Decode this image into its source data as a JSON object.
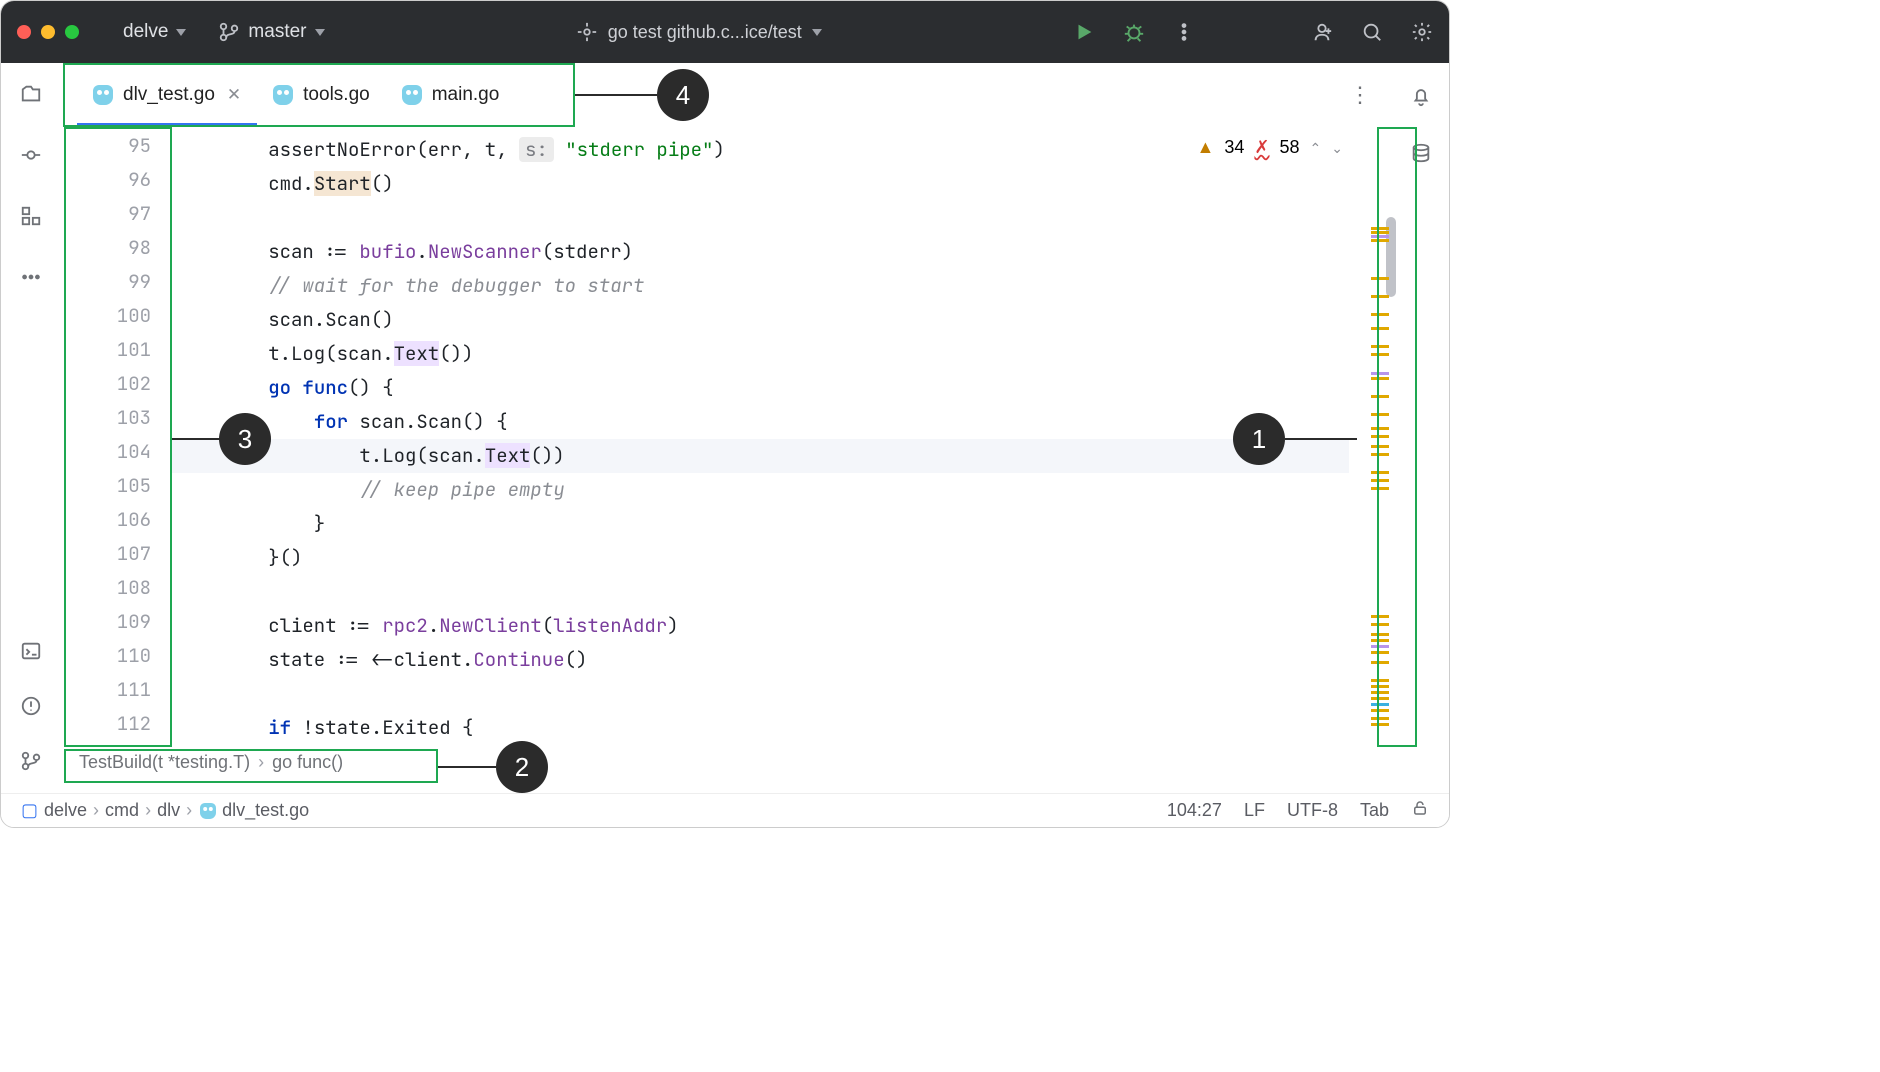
{
  "titlebar": {
    "project": "delve",
    "branch": "master",
    "run_config": "go test github.c...ice/test"
  },
  "tabs": [
    {
      "label": "dlv_test.go",
      "active": true,
      "closable": true
    },
    {
      "label": "tools.go",
      "active": false,
      "closable": false
    },
    {
      "label": "main.go",
      "active": false,
      "closable": false
    }
  ],
  "inspections": {
    "warnings": 34,
    "errors": 58
  },
  "code": {
    "first_line_no": 95,
    "current_line_no": 104,
    "lines": [
      {
        "n": 95,
        "indent": 2,
        "segments": [
          {
            "t": "assertNoError"
          },
          {
            "t": "(err, t, "
          },
          {
            "t": "s:",
            "cls": "hint-box"
          },
          {
            "t": " "
          },
          {
            "t": "\"stderr pipe\"",
            "cls": "str"
          },
          {
            "t": ")"
          }
        ]
      },
      {
        "n": 96,
        "indent": 2,
        "segments": [
          {
            "t": "cmd."
          },
          {
            "t": "Start",
            "cls": "hl"
          },
          {
            "t": "()"
          }
        ]
      },
      {
        "n": 97,
        "indent": 0,
        "segments": []
      },
      {
        "n": 98,
        "indent": 2,
        "segments": [
          {
            "t": "scan := "
          },
          {
            "t": "bufio",
            "cls": "fn"
          },
          {
            "t": "."
          },
          {
            "t": "NewScanner",
            "cls": "fn"
          },
          {
            "t": "(stderr)"
          }
        ]
      },
      {
        "n": 99,
        "indent": 2,
        "segments": [
          {
            "t": "// wait for the debugger to start",
            "cls": "cm"
          }
        ]
      },
      {
        "n": 100,
        "indent": 2,
        "segments": [
          {
            "t": "scan.Scan()"
          }
        ]
      },
      {
        "n": 101,
        "indent": 2,
        "segments": [
          {
            "t": "t.Log(scan."
          },
          {
            "t": "Text",
            "cls": "hl-purple"
          },
          {
            "t": "())"
          }
        ]
      },
      {
        "n": 102,
        "indent": 2,
        "segments": [
          {
            "t": "go",
            "cls": "kw"
          },
          {
            "t": " "
          },
          {
            "t": "func",
            "cls": "kw"
          },
          {
            "t": "() {"
          }
        ]
      },
      {
        "n": 103,
        "indent": 3,
        "segments": [
          {
            "t": "for",
            "cls": "kw"
          },
          {
            "t": " scan.Scan() {"
          }
        ]
      },
      {
        "n": 104,
        "indent": 4,
        "segments": [
          {
            "t": "t.Log(scan."
          },
          {
            "t": "Text",
            "cls": "hl-purple"
          },
          {
            "t": "())"
          }
        ],
        "current": true
      },
      {
        "n": 105,
        "indent": 4,
        "segments": [
          {
            "t": "// keep pipe empty",
            "cls": "cm"
          }
        ]
      },
      {
        "n": 106,
        "indent": 3,
        "segments": [
          {
            "t": "}"
          }
        ]
      },
      {
        "n": 107,
        "indent": 2,
        "segments": [
          {
            "t": "}()"
          }
        ]
      },
      {
        "n": 108,
        "indent": 0,
        "segments": []
      },
      {
        "n": 109,
        "indent": 2,
        "segments": [
          {
            "t": "client := "
          },
          {
            "t": "rpc2",
            "cls": "fn"
          },
          {
            "t": "."
          },
          {
            "t": "NewClient",
            "cls": "fn"
          },
          {
            "t": "("
          },
          {
            "t": "listenAddr",
            "cls": "fn"
          },
          {
            "t": ")"
          }
        ]
      },
      {
        "n": 110,
        "indent": 2,
        "segments": [
          {
            "t": "state := <-client."
          },
          {
            "t": "Continue",
            "cls": "fn"
          },
          {
            "t": "()"
          }
        ]
      },
      {
        "n": 111,
        "indent": 0,
        "segments": []
      },
      {
        "n": 112,
        "indent": 2,
        "segments": [
          {
            "t": "if",
            "cls": "kw"
          },
          {
            "t": " !state.Exited {"
          }
        ]
      }
    ]
  },
  "breadcrumbs_code": [
    "TestBuild(t *testing.T)",
    "go func()"
  ],
  "breadcrumbs_nav": [
    "delve",
    "cmd",
    "dlv",
    "dlv_test.go"
  ],
  "status": {
    "caret": "104:27",
    "line_sep": "LF",
    "encoding": "UTF-8",
    "indent": "Tab"
  },
  "callouts": {
    "1": "1",
    "2": "2",
    "3": "3",
    "4": "4"
  }
}
